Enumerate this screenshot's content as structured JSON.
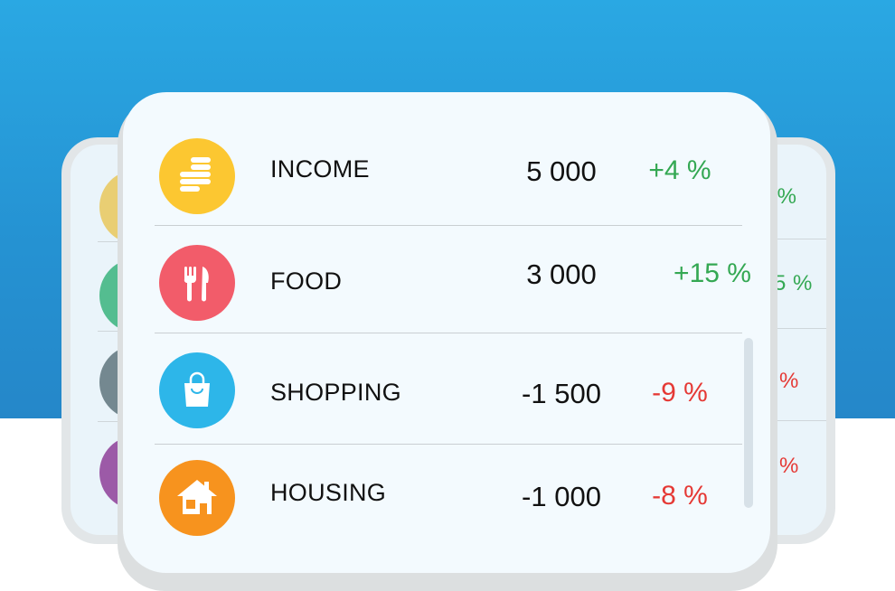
{
  "rows": [
    {
      "label": "INCOME",
      "amount": "5 000",
      "change": "+4 %",
      "icon": "coins-icon",
      "color": "#fcc731"
    },
    {
      "label": "FOOD",
      "amount": "3 000",
      "change": "+15 %",
      "icon": "fork-knife-icon",
      "color": "#f25c6a"
    },
    {
      "label": "SHOPPING",
      "amount": "-1 500",
      "change": "-9 %",
      "icon": "shopping-bag-icon",
      "color": "#2db6e9"
    },
    {
      "label": "HOUSING",
      "amount": "-1 000",
      "change": "-8 %",
      "icon": "house-icon",
      "color": "#f7931e"
    }
  ],
  "back_card_right": {
    "changes": [
      "- %",
      "5 %",
      "%",
      "%"
    ]
  },
  "colors": {
    "positive": "#34a853",
    "negative": "#e53935",
    "background_top": "#2aa8e3"
  }
}
